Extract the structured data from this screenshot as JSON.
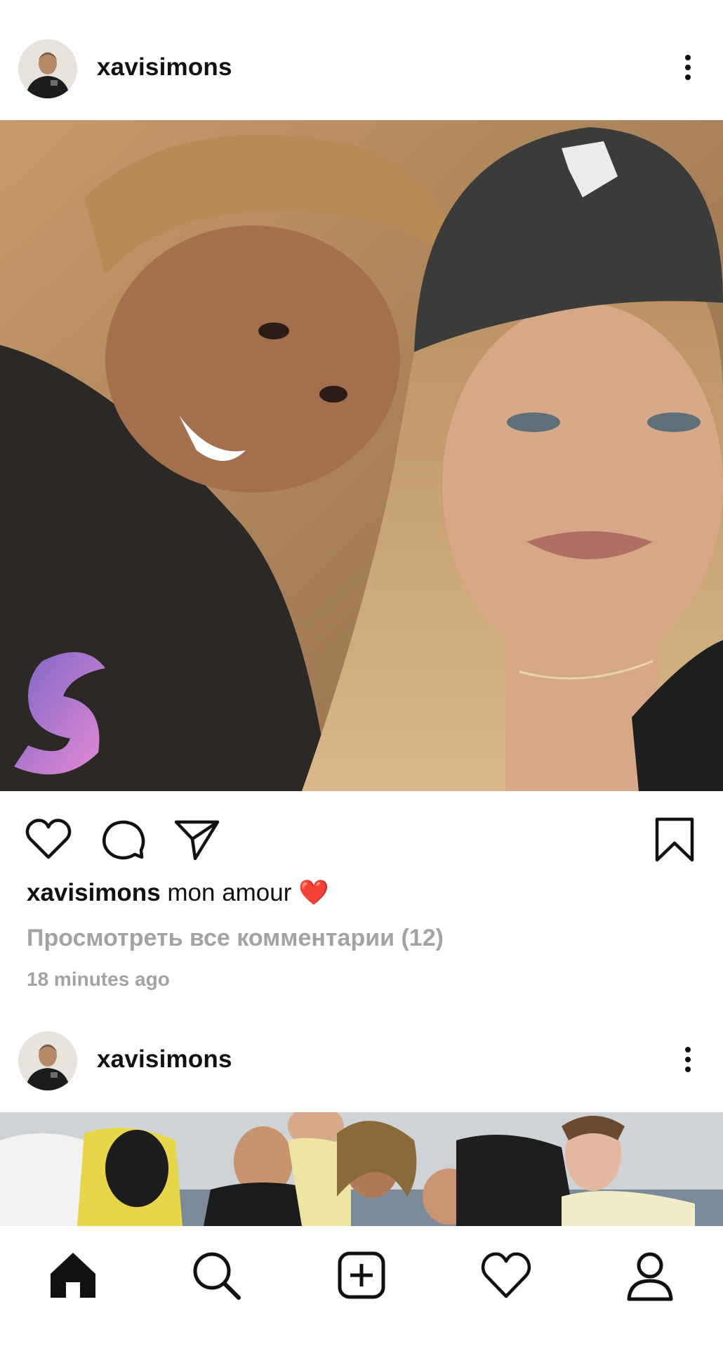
{
  "post1": {
    "username": "xavisimons",
    "caption_text": " mon amour ❤️",
    "view_comments": "Просмотреть все комментарии (12)",
    "time": "18 minutes ago"
  },
  "post2": {
    "username": "xavisimons"
  },
  "icons": {
    "more": "more-vertical-icon",
    "like": "heart-outline-icon",
    "comment": "comment-bubble-icon",
    "share": "paper-plane-icon",
    "save": "bookmark-icon",
    "home": "home-filled-icon",
    "search": "search-icon",
    "create": "plus-square-icon",
    "activity": "heart-outline-icon",
    "profile": "user-icon"
  },
  "colors": {
    "heart_emoji": "#e0245e",
    "muted_text": "#a3a3a3"
  }
}
